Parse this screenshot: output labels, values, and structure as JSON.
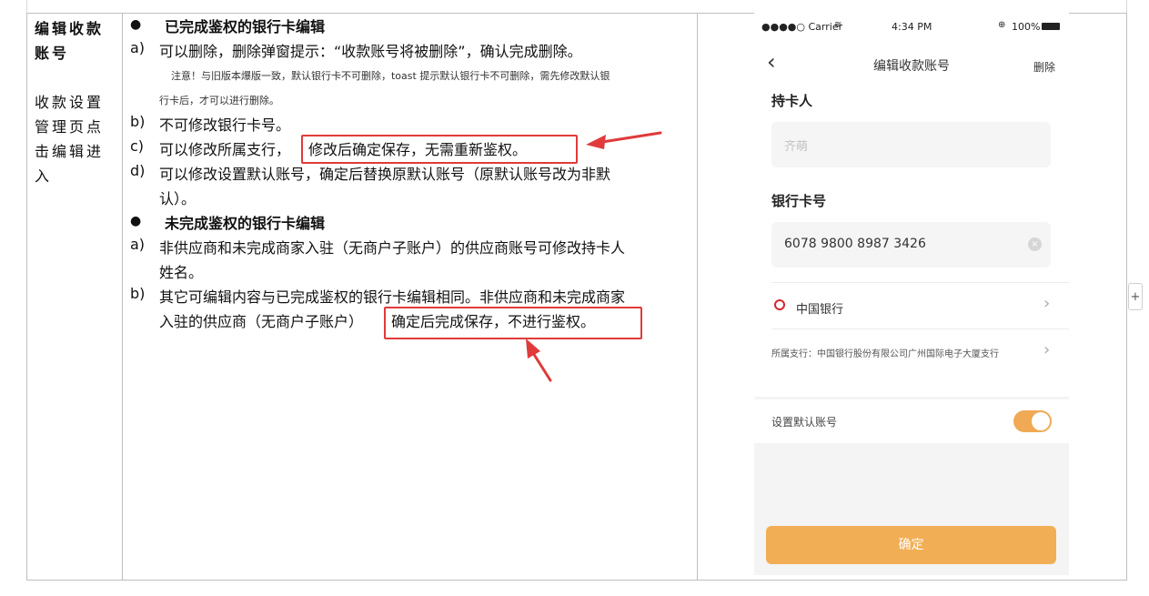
{
  "col1": {
    "title_lines": [
      "编辑收款",
      "账号"
    ],
    "desc_lines": [
      "收款设置",
      "管理页点",
      "击编辑进",
      "入"
    ]
  },
  "middle": {
    "bullet1": "已完成鉴权的银行卡编辑",
    "a_marker": "a)",
    "a_text": "可以删除，删除弹窗提示：“收款账号将被删除”，确认完成删除。",
    "note_line1": "注意！与旧版本爆版一致，默认银行卡不可删除，toast 提示默认银行卡不可删除，需先修改默认银",
    "note_line2": "行卡后，才可以进行删除。",
    "b_marker": "b)",
    "b_text": "不可修改银行卡号。",
    "c_marker": "c)",
    "c_text_prefix": "可以修改所属支行，",
    "c_text_boxed": "修改后确定保存，无需重新鉴权。",
    "d_marker": "d)",
    "d_text_line1": "可以修改设置默认账号，确定后替换原默认账号（原默认账号改为非默",
    "d_text_line2": "认）。",
    "bullet2": "未完成鉴权的银行卡编辑",
    "a2_marker": "a)",
    "a2_line1": "非供应商和未完成商家入驻（无商户子账户）的供应商账号可修改持卡人",
    "a2_line2": "姓名。",
    "b2_marker": "b)",
    "b2_line1": "其它可编辑内容与已完成鉴权的银行卡编辑相同。非供应商和未完成商家",
    "b2_line2_prefix": "入驻的供应商（无商户子账户）",
    "b2_line2_boxed": "确定后完成保存，不进行鉴权。"
  },
  "phone": {
    "status": {
      "carrier": "●●●●○ Carrier",
      "time": "4:34 PM",
      "battery": "100%"
    },
    "nav": {
      "title": "编辑收款账号",
      "right_action": "删除"
    },
    "holder_label": "持卡人",
    "holder_placeholder": "齐萌",
    "card_label": "银行卡号",
    "card_value": "6078 9800 8987 3426",
    "bank_name": "中国银行",
    "branch_text": "所属支行：中国银行股份有限公司广州国际电子大厦支行",
    "default_label": "设置默认账号",
    "default_on": true,
    "confirm_button": "确定"
  },
  "colors": {
    "accent": "#f2ae55",
    "annotation_red": "#e03a3a",
    "bank_red": "#d7262f"
  }
}
